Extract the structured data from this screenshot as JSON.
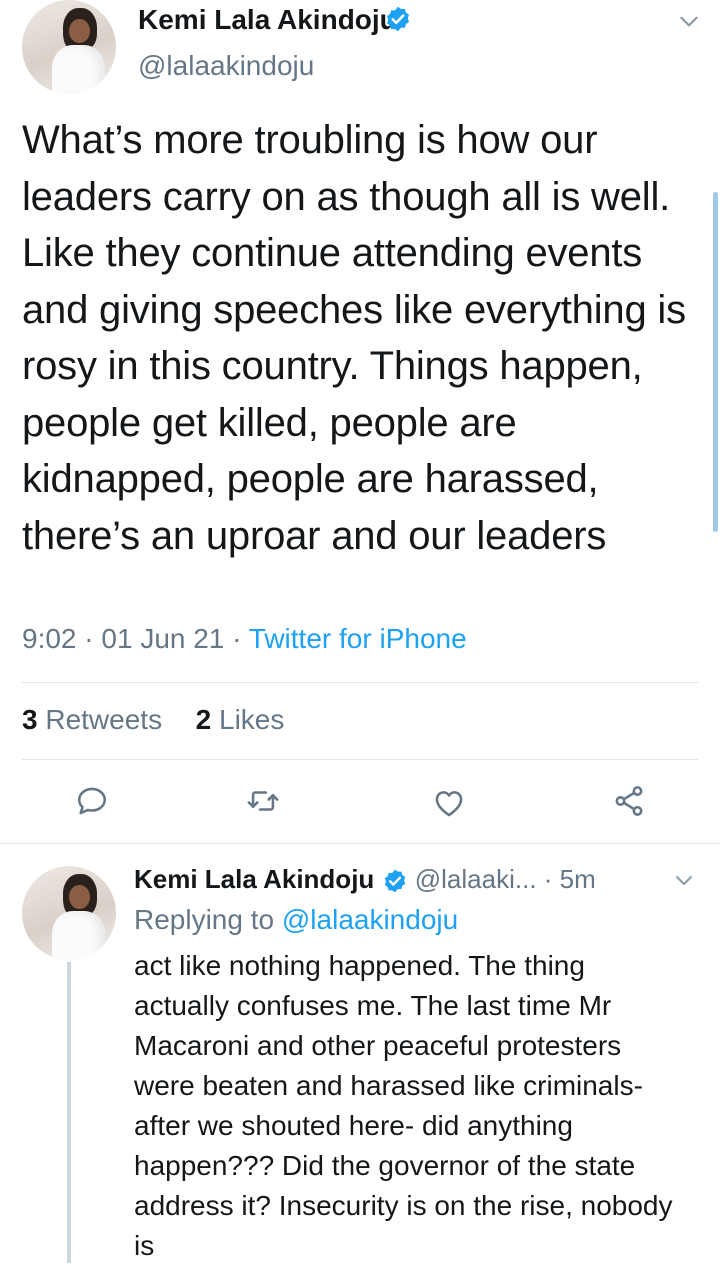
{
  "main_tweet": {
    "author_name": "Kemi Lala Akindoju",
    "author_handle": "@lalaakindoju",
    "text": "What’s more troubling is how our leaders carry on as though all is well. Like they continue attending events and giving speeches like everything is rosy in this country. Things happen, people get killed, people are kidnapped, people are harassed, there’s an uproar and our leaders",
    "time": "9:02",
    "date": "01 Jun 21",
    "source": "Twitter for iPhone",
    "retweets_count": "3",
    "retweets_label": "Retweets",
    "likes_count": "2",
    "likes_label": "Likes"
  },
  "reply_tweet": {
    "author_name": "Kemi Lala Akindoju",
    "author_handle": "@lalaaki...",
    "time_ago": "5m",
    "replying_to_label": "Replying to",
    "replying_to_handle": "@lalaakindoju",
    "text": "act like nothing happened. The thing actually confuses me. The last time Mr Macaroni and other peaceful protesters were beaten and harassed like criminals-after we shouted here- did anything happen??? Did the governor of the state address it? Insecurity is on the rise, nobody is"
  },
  "icons": [
    "verified-badge-icon",
    "chevron-down-icon",
    "reply-icon",
    "retweet-icon",
    "like-icon",
    "share-icon"
  ],
  "colors": {
    "accent": "#1da1f2",
    "secondary_text": "#657786",
    "divider": "#e1e8ed"
  }
}
